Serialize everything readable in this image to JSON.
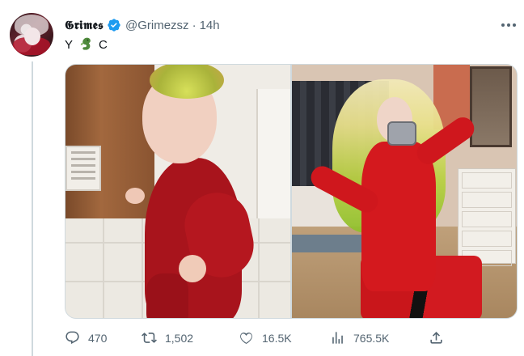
{
  "tweet": {
    "author": {
      "display_name": "𝕲𝖗𝖎𝖒𝖊𝖘",
      "handle": "@Grimezsz",
      "verified": true,
      "avatar_icon": "avatar"
    },
    "separator": "·",
    "timestamp": "14h",
    "text_parts": [
      "Y",
      "C"
    ],
    "text_emoji": "seahorse-emoji-icon",
    "media": [
      {
        "kind": "photo",
        "description_icon": "toddler-photo"
      },
      {
        "kind": "photo",
        "description_icon": "mirror-selfie-photo"
      }
    ],
    "actions": {
      "replies": "470",
      "retweets": "1,502",
      "likes": "16.5K",
      "views": "765.5K"
    }
  },
  "colors": {
    "text_primary": "#0f1419",
    "text_secondary": "#536471",
    "verified_blue": "#1d9bf0",
    "border": "#cfd9de"
  }
}
